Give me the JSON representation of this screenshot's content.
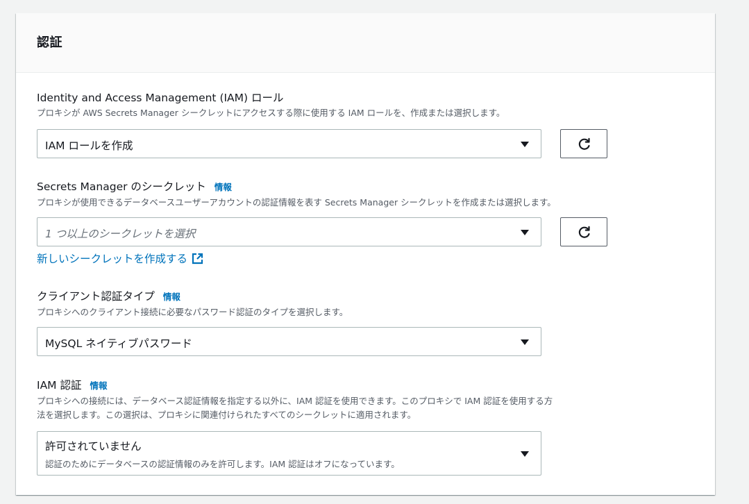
{
  "panel": {
    "title": "認証"
  },
  "iam_role": {
    "label": "Identity and Access Management (IAM) ロール",
    "description": "プロキシが AWS Secrets Manager シークレットにアクセスする際に使用する IAM ロールを、作成または選択します。",
    "selected": "IAM ロールを作成"
  },
  "secrets": {
    "label": "Secrets Manager のシークレット",
    "info": "情報",
    "description": "プロキシが使用できるデータベースユーザーアカウントの認証情報を表す Secrets Manager シークレットを作成または選択します。",
    "placeholder": "1 つ以上のシークレットを選択",
    "create_link": "新しいシークレットを作成する"
  },
  "client_auth": {
    "label": "クライアント認証タイプ",
    "info": "情報",
    "description": "プロキシへのクライアント接続に必要なパスワード認証のタイプを選択します。",
    "selected": "MySQL ネイティブパスワード"
  },
  "iam_auth": {
    "label": "IAM 認証",
    "info": "情報",
    "description_line1": "プロキシへの接続には、データベース認証情報を指定する以外に、IAM 認証を使用できます。このプロキシで IAM 認証を使用する方",
    "description_line2": "法を選択します。この選択は、プロキシに関連付けられたすべてのシークレットに適用されます。",
    "selected": "許可されていません",
    "selected_description": "認証のためにデータベースの認証情報のみを許可します。IAM 認証はオフになっています。"
  },
  "icons": {
    "refresh": "refresh-icon",
    "caret": "caret-down-icon",
    "external": "external-link-icon"
  },
  "colors": {
    "link": "#0073bb",
    "text": "#16191f",
    "muted": "#545b64",
    "border": "#aab7b8"
  }
}
